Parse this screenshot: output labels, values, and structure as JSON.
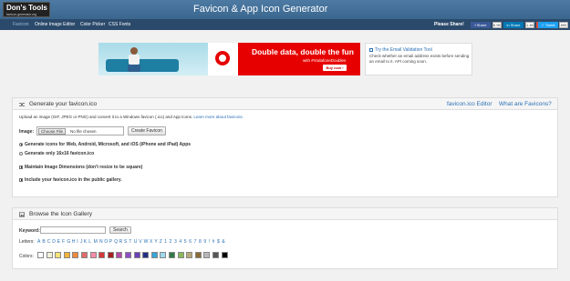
{
  "header": {
    "logo_line1": "Don's Tools",
    "logo_line2": "favicon-generator.org",
    "title": "Favicon & App Icon Generator"
  },
  "nav": {
    "items": [
      "Favicon",
      "Online Image Editor",
      "Color Picker",
      "CSS Fonts"
    ],
    "share_label": "Please Share!",
    "share_buttons": [
      {
        "label": "Share",
        "count": "6.5K",
        "color": "#3b5998",
        "icon": "facebook-icon"
      },
      {
        "label": "Share",
        "count": "1.4K",
        "color": "#0077b5",
        "icon": "linkedin-icon"
      },
      {
        "label": "G+",
        "count": "",
        "color": "#dd4b39",
        "icon": "google-plus-icon"
      },
      {
        "label": "Tweet",
        "count": "895",
        "color": "#1da1f2",
        "icon": "twitter-icon"
      }
    ]
  },
  "ad": {
    "headline": "Double data, double the fun",
    "tagline": "with #VodafoneDoubles",
    "button": "Buy now ›"
  },
  "tool": {
    "link": "Try the Email Validation Tool",
    "description": "Check whether an email address exists before sending an email to it. API coming soon."
  },
  "generate": {
    "title": "Generate your favicon.ico",
    "links": [
      "favicon.ico Editor",
      "What are Favicons?"
    ],
    "intro_text": "Upload an image (GIF, JPEG or PNG) and convert it to a Windows favicon (.ico) and App Icons.",
    "intro_link": "Learn more about favicons.",
    "image_label": "Image:",
    "choose_file": "Choose File",
    "no_file": "No file chosen",
    "create_button": "Create Favicon",
    "options": [
      {
        "type": "radio",
        "checked": true,
        "bold": "Generate icons for Web, Android, Microsoft, and iOS (iPhone and iPad) Apps",
        "rest": ""
      },
      {
        "type": "radio",
        "checked": false,
        "bold": "",
        "rest": "Generate only 16x16 favicon.ico"
      },
      {
        "type": "checkbox",
        "checked": true,
        "bold": "Maintain Image Dimensions (don't resize to be square)",
        "rest": ""
      },
      {
        "type": "checkbox",
        "checked": true,
        "bold": "Include your favicon.ico in the public gallery.",
        "rest": ""
      }
    ]
  },
  "gallery": {
    "title": "Browse the Icon Gallery",
    "keyword_label": "Keyword:",
    "search_button": "Search",
    "letters_label": "Letters:",
    "letters": [
      "A",
      "B",
      "C",
      "D",
      "E",
      "F",
      "G",
      "H",
      "I",
      "J",
      "K",
      "L",
      "M",
      "N",
      "O",
      "P",
      "Q",
      "R",
      "S",
      "T",
      "U",
      "V",
      "W",
      "X",
      "Y",
      "Z",
      "1",
      "2",
      "3",
      "4",
      "5",
      "6",
      "7",
      "8",
      "9",
      "!",
      "#",
      "$",
      "&"
    ],
    "colors_label": "Colors:",
    "colors": [
      "#ffffff",
      "#f3f0d8",
      "#f5e27a",
      "#f2b43c",
      "#ee8a3a",
      "#e46a6a",
      "#f58ca8",
      "#d43838",
      "#a61f1f",
      "#b54aa8",
      "#8e4fc6",
      "#6a42b8",
      "#1f2f86",
      "#38a6d6",
      "#9fd8ef",
      "#2f7a46",
      "#8bb85a",
      "#b7a87a",
      "#8a6a36",
      "#b7b7b7",
      "#555555",
      "#000000"
    ]
  }
}
